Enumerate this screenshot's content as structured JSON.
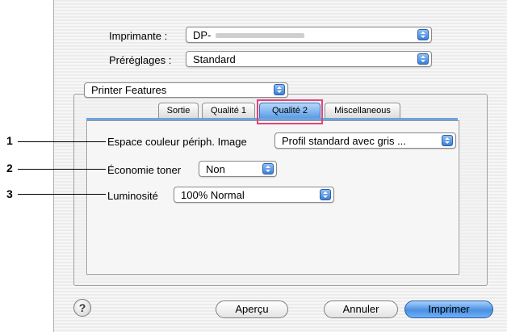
{
  "printer": {
    "label": "Imprimante :",
    "value": "DP-"
  },
  "presets": {
    "label": "Préréglages :",
    "value": "Standard"
  },
  "features_popup": {
    "value": "Printer Features"
  },
  "tabs": [
    {
      "label": "Sortie"
    },
    {
      "label": "Qualité 1"
    },
    {
      "label": "Qualité 2"
    },
    {
      "label": "Miscellaneous"
    }
  ],
  "settings": {
    "color_space": {
      "label": "Espace couleur périph. Image",
      "value": "Profil standard avec gris ..."
    },
    "toner": {
      "label": "Économie toner",
      "value": "Non"
    },
    "brightness": {
      "label": "Luminosité",
      "value": "100% Normal"
    }
  },
  "callouts": [
    "1",
    "2",
    "3"
  ],
  "buttons": {
    "help": "?",
    "preview": "Aperçu",
    "cancel": "Annuler",
    "print": "Imprimer"
  },
  "colors": {
    "accent": "#3d7fd8",
    "highlight": "#e0457c"
  }
}
